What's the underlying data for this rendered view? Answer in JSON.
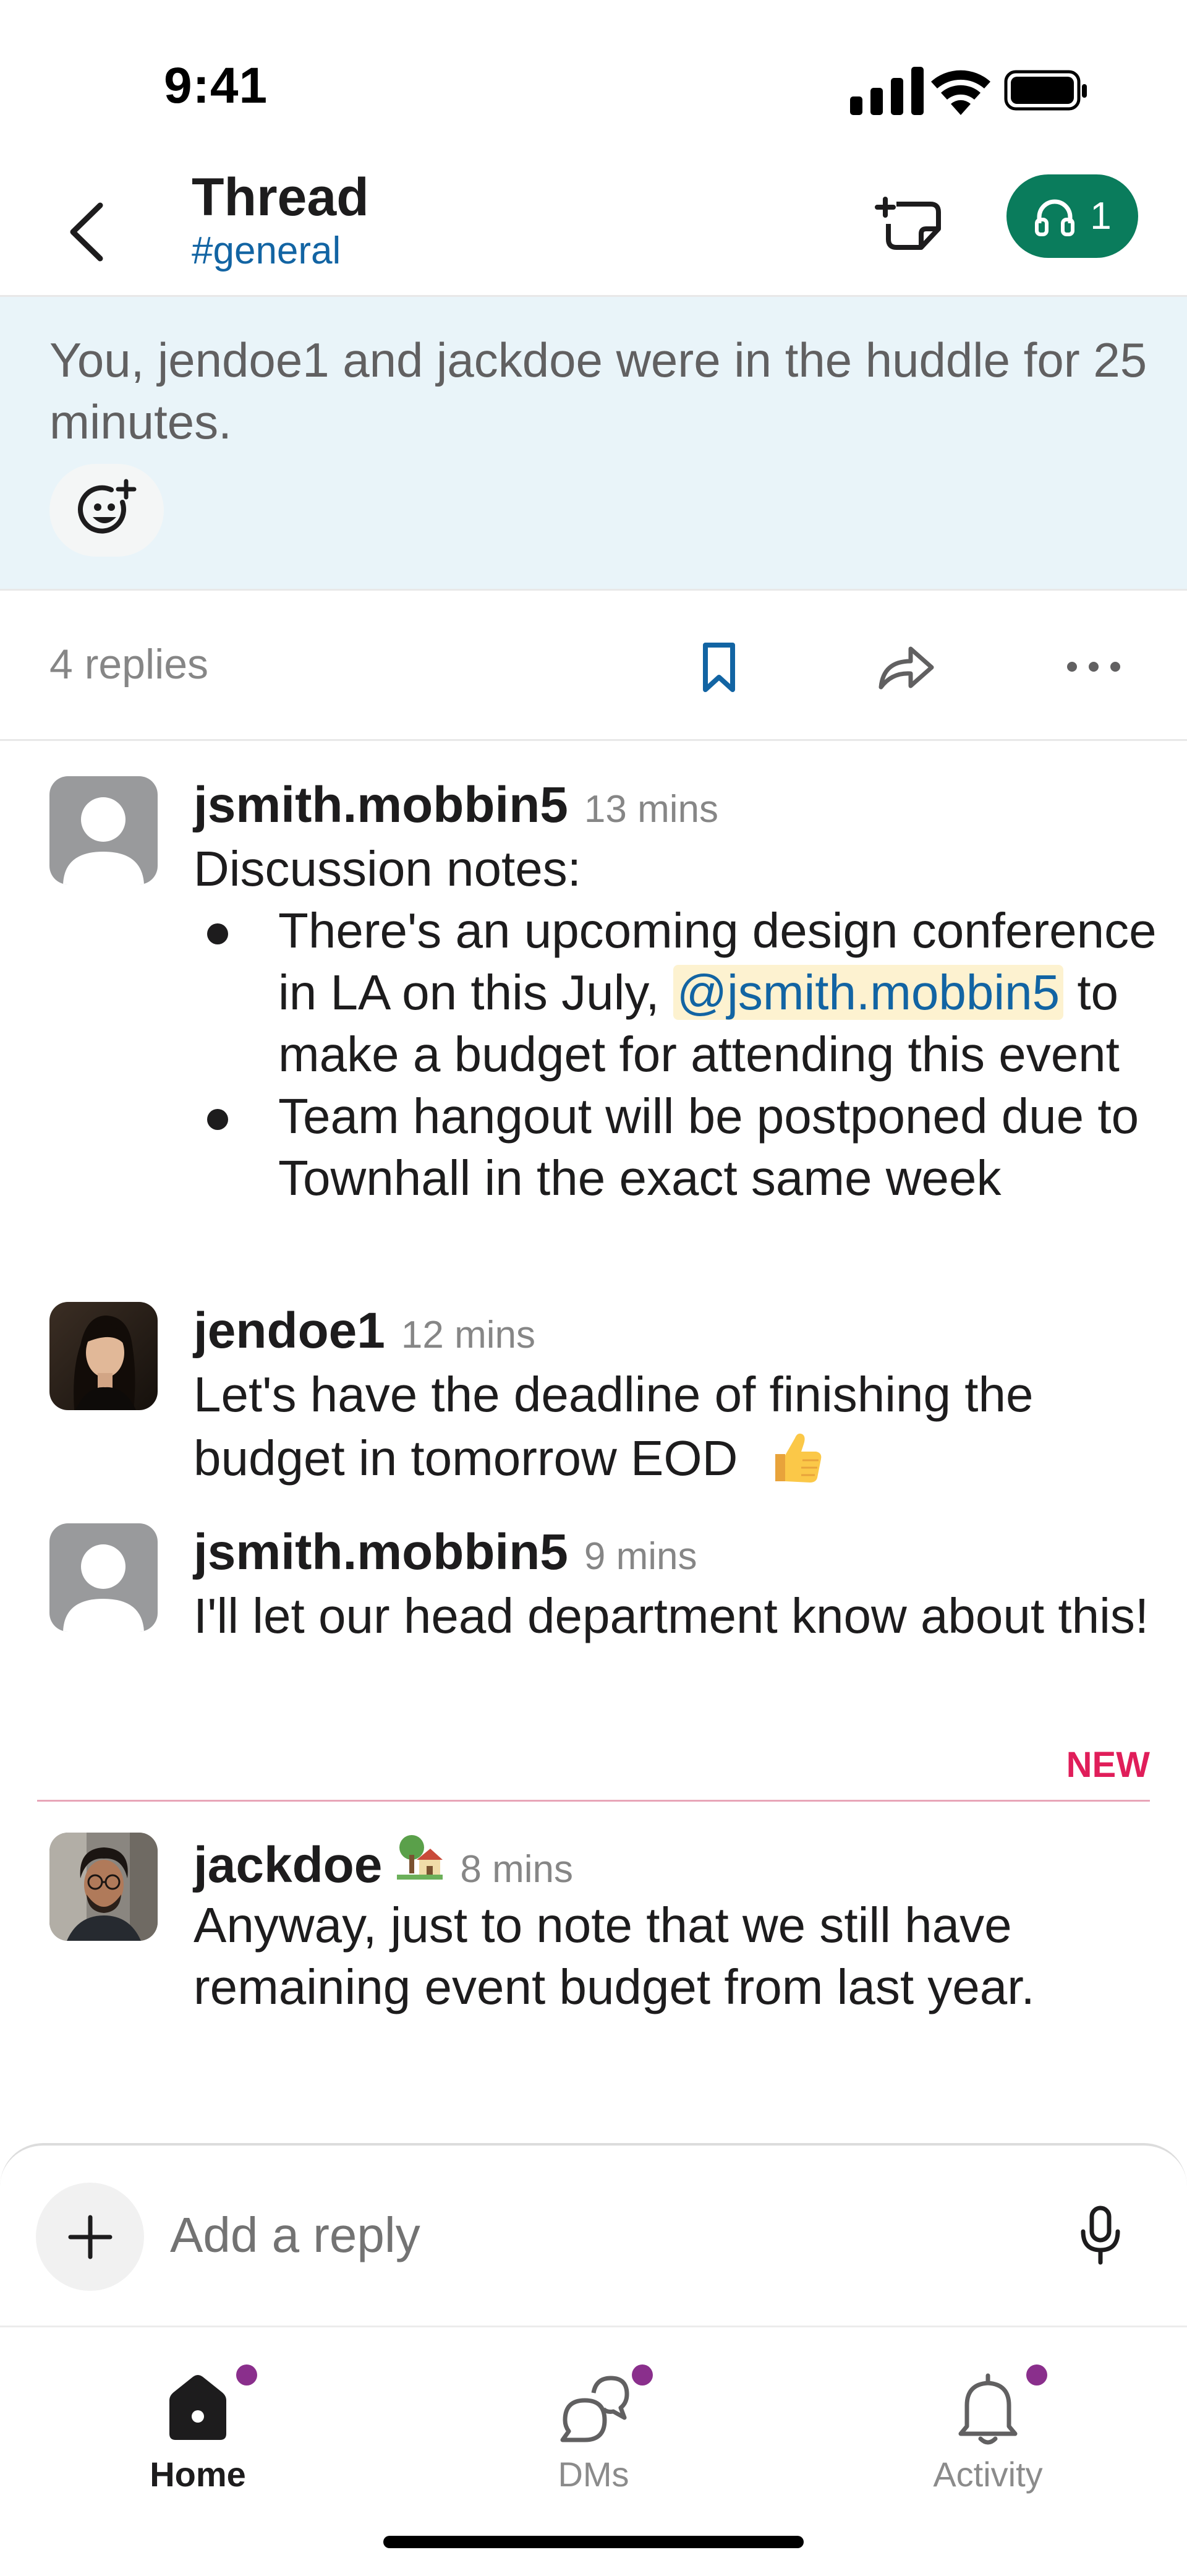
{
  "status_bar": {
    "time": "9:41"
  },
  "header": {
    "title": "Thread",
    "channel": "#general",
    "huddle_count": "1"
  },
  "parent_message": {
    "text": "You, jendoe1 and jackdoe were in the huddle for 25 minutes."
  },
  "reply_bar": {
    "replies": "4 replies"
  },
  "messages": [
    {
      "author": "jsmith.mobbin5",
      "time": "13 mins",
      "intro": "Discussion notes:",
      "bullet1_before": "There's an upcoming design conference in LA on this July, ",
      "bullet1_mention": "@jsmith.mobbin5",
      "bullet1_after": " to make a budget for attending this event",
      "bullet2": "Team hangout will be postponed due to Townhall in the exact same week"
    },
    {
      "author": "jendoe1",
      "time": "12 mins",
      "text": "Let's have the deadline of finishing the budget in tomorrow EOD"
    },
    {
      "author": "jsmith.mobbin5",
      "time": "9 mins",
      "text": "I'll let our head department know about this!"
    },
    {
      "author": "jackdoe",
      "time": "8 mins",
      "text": "Anyway, just to note that we still have remaining event budget from last year."
    }
  ],
  "new_divider": {
    "label": "NEW"
  },
  "composer": {
    "placeholder": "Add a reply"
  },
  "tabs": [
    {
      "label": "Home",
      "icon": "home-icon",
      "active": true
    },
    {
      "label": "DMs",
      "icon": "dms-icon",
      "active": false
    },
    {
      "label": "Activity",
      "icon": "bell-icon",
      "active": false
    }
  ],
  "colors": {
    "accent_green": "#0a7c5c",
    "link": "#1264a3",
    "banner": "#e9f4f9",
    "new": "#e01e5a",
    "unread_dot": "#8a2f8c"
  }
}
